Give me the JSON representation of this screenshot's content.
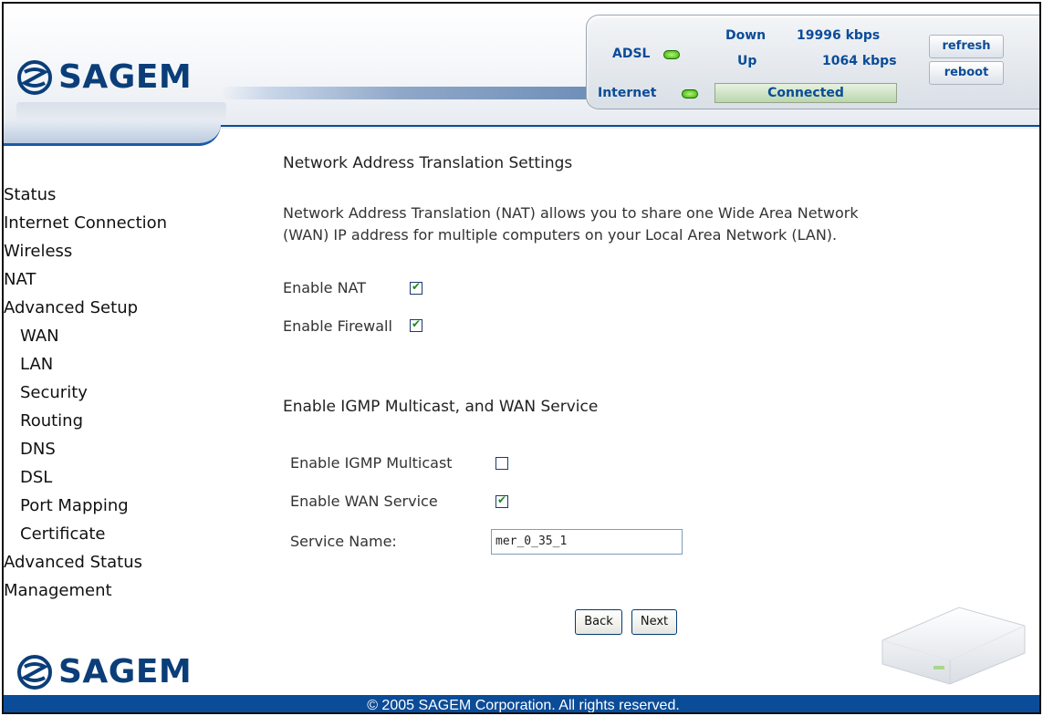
{
  "brand": {
    "logo_text": "SAGEM",
    "colors": {
      "brand_blue": "#0b4c98",
      "led_green": "#33b200"
    }
  },
  "status_panel": {
    "adsl_label": "ADSL",
    "internet_label": "Internet",
    "down_label": "Down",
    "up_label": "Up",
    "down_rate": "19996 kbps",
    "up_rate": "1064 kbps",
    "connection_state": "Connected",
    "refresh_label": "refresh",
    "reboot_label": "reboot"
  },
  "sidebar": {
    "items": [
      {
        "label": "Status",
        "sub": false
      },
      {
        "label": "Internet Connection",
        "sub": false
      },
      {
        "label": "Wireless",
        "sub": false
      },
      {
        "label": "NAT",
        "sub": false
      },
      {
        "label": "Advanced Setup",
        "sub": false
      },
      {
        "label": "WAN",
        "sub": true
      },
      {
        "label": "LAN",
        "sub": true
      },
      {
        "label": "Security",
        "sub": true
      },
      {
        "label": "Routing",
        "sub": true
      },
      {
        "label": "DNS",
        "sub": true
      },
      {
        "label": "DSL",
        "sub": true
      },
      {
        "label": "Port Mapping",
        "sub": true
      },
      {
        "label": "Certificate",
        "sub": true
      },
      {
        "label": "Advanced Status",
        "sub": false
      },
      {
        "label": "Management",
        "sub": false
      }
    ]
  },
  "main": {
    "title": "Network Address Translation Settings",
    "description_line1": "Network Address Translation (NAT) allows you to share one Wide Area Network",
    "description_line2": "(WAN) IP address for multiple computers on your Local Area Network (LAN).",
    "enable_nat_label": "Enable NAT",
    "enable_nat_checked": true,
    "enable_firewall_label": "Enable Firewall",
    "enable_firewall_checked": true,
    "igmp_section_title": "Enable IGMP Multicast, and WAN Service",
    "igmp_label": "Enable IGMP Multicast",
    "igmp_checked": false,
    "wan_service_label": "Enable WAN Service",
    "wan_service_checked": true,
    "service_name_label": "Service Name:",
    "service_name_value": "mer_0_35_1",
    "back_label": "Back",
    "next_label": "Next"
  },
  "footer": {
    "copyright": "© 2005 SAGEM Corporation. All rights reserved."
  }
}
